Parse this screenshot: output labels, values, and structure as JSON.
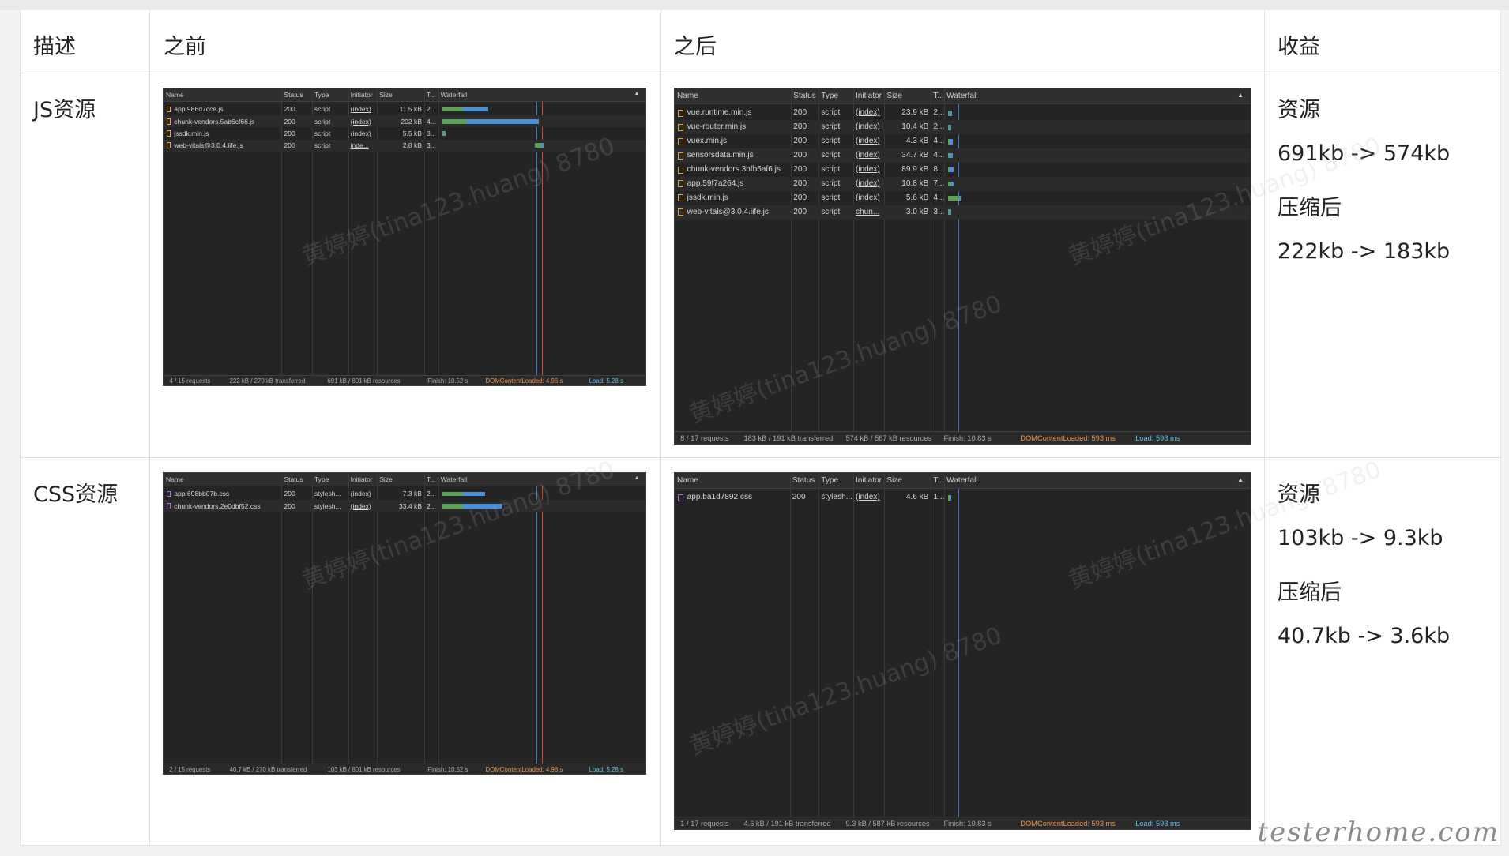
{
  "table": {
    "headers": [
      "描述",
      "之前",
      "之后",
      "收益"
    ],
    "rows": [
      {
        "label": "JS资源",
        "gain": [
          "资源",
          "691kb -> 574kb",
          "压缩后",
          "222kb -> 183kb"
        ]
      },
      {
        "label": "CSS资源",
        "gain": [
          "资源",
          "103kb -> 9.3kb",
          "压缩后",
          "40.7kb -> 3.6kb"
        ]
      }
    ]
  },
  "devtools": {
    "columns": [
      "Name",
      "Status",
      "Type",
      "Initiator",
      "Size",
      "T...",
      "Waterfall"
    ],
    "sort_icon": "▲",
    "js_before": {
      "rows": [
        {
          "name": "app.986d7cce.js",
          "status": "200",
          "type": "script",
          "initiator": "(index)",
          "size": "11.5 kB",
          "time": "2..."
        },
        {
          "name": "chunk-vendors.5ab6cf66.js",
          "status": "200",
          "type": "script",
          "initiator": "(index)",
          "size": "202 kB",
          "time": "4..."
        },
        {
          "name": "jssdk.min.js",
          "status": "200",
          "type": "script",
          "initiator": "(index)",
          "size": "5.5 kB",
          "time": "3..."
        },
        {
          "name": "web-vitals@3.0.4.iife.js",
          "status": "200",
          "type": "script",
          "initiator": "inde...",
          "size": "2.8 kB",
          "time": "3..."
        }
      ],
      "footer": {
        "requests": "4 / 15 requests",
        "transferred": "222 kB / 270 kB transferred",
        "resources": "691 kB / 801 kB resources",
        "finish": "Finish: 10.52 s",
        "dcl": "DOMContentLoaded: 4.96 s",
        "load": "Load: 5.28 s"
      }
    },
    "js_after": {
      "rows": [
        {
          "name": "vue.runtime.min.js",
          "status": "200",
          "type": "script",
          "initiator": "(index)",
          "size": "23.9 kB",
          "time": "2..."
        },
        {
          "name": "vue-router.min.js",
          "status": "200",
          "type": "script",
          "initiator": "(index)",
          "size": "10.4 kB",
          "time": "2..."
        },
        {
          "name": "vuex.min.js",
          "status": "200",
          "type": "script",
          "initiator": "(index)",
          "size": "4.3 kB",
          "time": "4..."
        },
        {
          "name": "sensorsdata.min.js",
          "status": "200",
          "type": "script",
          "initiator": "(index)",
          "size": "34.7 kB",
          "time": "4..."
        },
        {
          "name": "chunk-vendors.3bfb5af6.js",
          "status": "200",
          "type": "script",
          "initiator": "(index)",
          "size": "89.9 kB",
          "time": "8..."
        },
        {
          "name": "app.59f7a264.js",
          "status": "200",
          "type": "script",
          "initiator": "(index)",
          "size": "10.8 kB",
          "time": "7..."
        },
        {
          "name": "jssdk.min.js",
          "status": "200",
          "type": "script",
          "initiator": "(index)",
          "size": "5.6 kB",
          "time": "4..."
        },
        {
          "name": "web-vitals@3.0.4.iife.js",
          "status": "200",
          "type": "script",
          "initiator": "chun...",
          "size": "3.0 kB",
          "time": "3..."
        }
      ],
      "footer": {
        "requests": "8 / 17 requests",
        "transferred": "183 kB / 191 kB transferred",
        "resources": "574 kB / 587 kB resources",
        "finish": "Finish: 10.83 s",
        "dcl": "DOMContentLoaded: 593 ms",
        "load": "Load: 593 ms"
      }
    },
    "css_before": {
      "rows": [
        {
          "name": "app.698bb07b.css",
          "status": "200",
          "type": "stylesh...",
          "initiator": "(index)",
          "size": "7.3 kB",
          "time": "2..."
        },
        {
          "name": "chunk-vendors.2e0dbf52.css",
          "status": "200",
          "type": "stylesh...",
          "initiator": "(index)",
          "size": "33.4 kB",
          "time": "2..."
        }
      ],
      "footer": {
        "requests": "2 / 15 requests",
        "transferred": "40.7 kB / 270 kB transferred",
        "resources": "103 kB / 801 kB resources",
        "finish": "Finish: 10.52 s",
        "dcl": "DOMContentLoaded: 4.96 s",
        "load": "Load: 5.28 s"
      }
    },
    "css_after": {
      "rows": [
        {
          "name": "app.ba1d7892.css",
          "status": "200",
          "type": "stylesh...",
          "initiator": "(index)",
          "size": "4.6 kB",
          "time": "1..."
        }
      ],
      "footer": {
        "requests": "1 / 17 requests",
        "transferred": "4.6 kB / 191 kB transferred",
        "resources": "9.3 kB / 587 kB resources",
        "finish": "Finish: 10.83 s",
        "dcl": "DOMContentLoaded: 593 ms",
        "load": "Load: 593 ms"
      }
    }
  },
  "watermark": "黄婷婷(tina123.huang) 8780",
  "logo": "testerhome.com",
  "colors": {
    "waterfall_green": "#5fa05a",
    "waterfall_blue": "#4a8fd8",
    "dcl_line": "#3a78d8",
    "load_line": "#d84040"
  }
}
